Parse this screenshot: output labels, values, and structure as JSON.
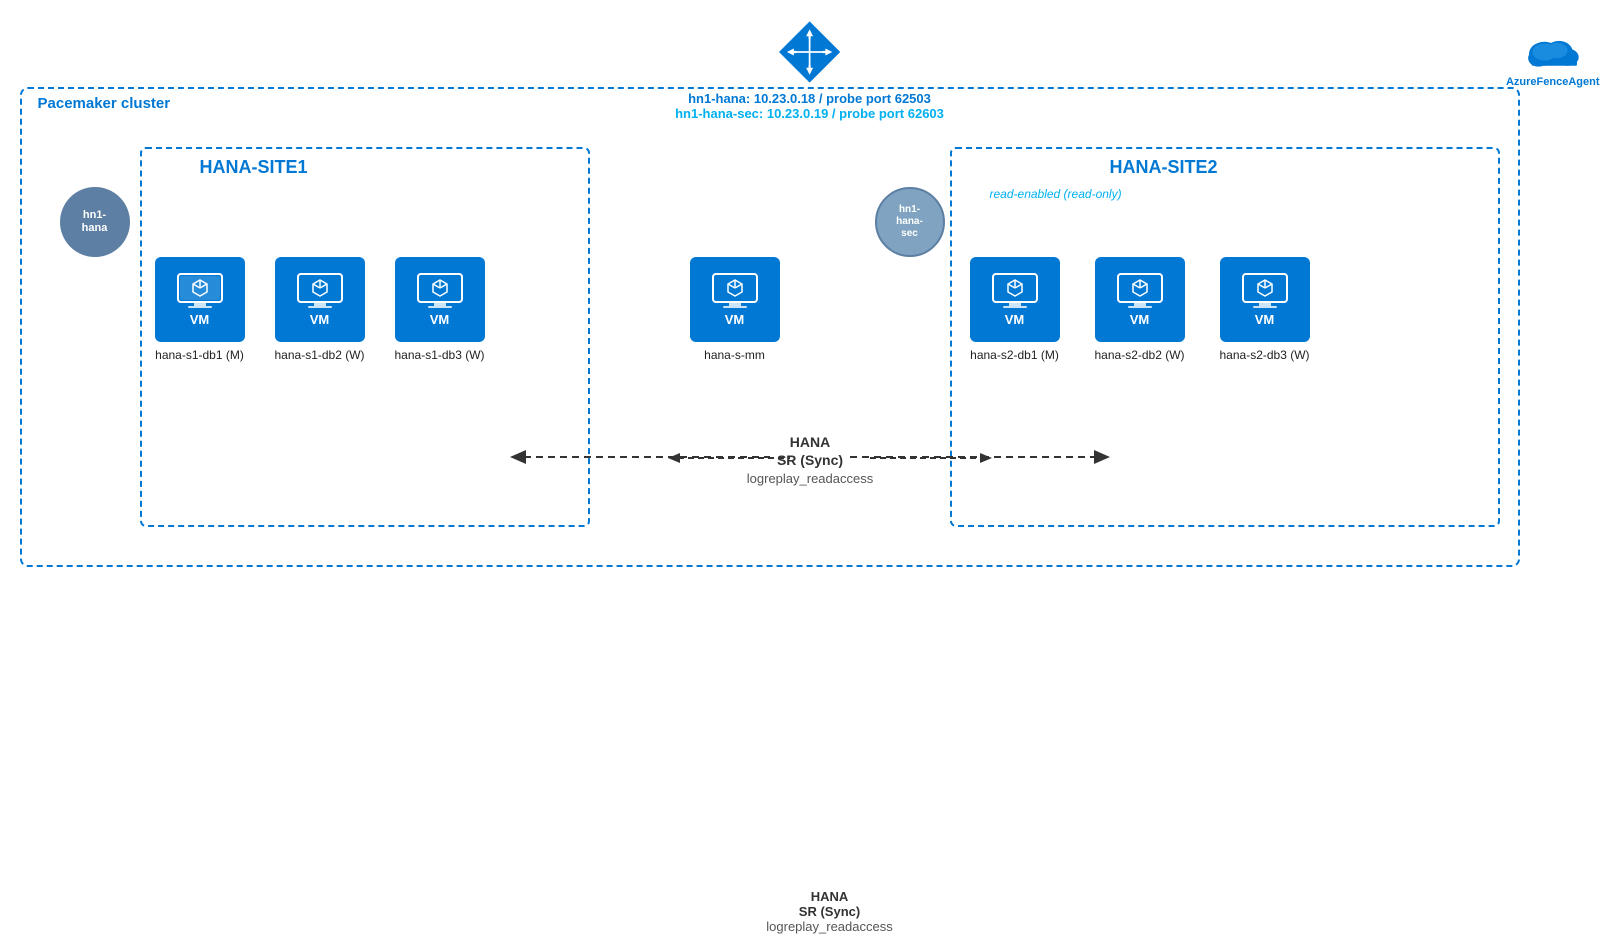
{
  "pacemaker": {
    "cluster_label": "Pacemaker cluster"
  },
  "lb": {
    "primary": "hn1-hana:  10.23.0.18 / probe port 62503",
    "secondary": "hn1-hana-sec:  10.23.0.19 / probe port 62603"
  },
  "azure_fence": {
    "label": "AzureFenceAgent"
  },
  "site1": {
    "label": "HANA-SITE1",
    "node_circle": "hn1-\nhana"
  },
  "site2": {
    "label": "HANA-SITE2",
    "node_circle": "hn1-\nhana-\nsec",
    "read_enabled": "read-enabled (read-only)"
  },
  "vms": [
    {
      "id": "s1-db1",
      "name": "hana-s1-db1 (M)"
    },
    {
      "id": "s1-db2",
      "name": "hana-s1-db2 (W)"
    },
    {
      "id": "s1-db3",
      "name": "hana-s1-db3 (W)"
    },
    {
      "id": "s-mm",
      "name": "hana-s-mm"
    },
    {
      "id": "s2-db1",
      "name": "hana-s2-db1 (M)"
    },
    {
      "id": "s2-db2",
      "name": "hana-s2-db2 (W)"
    },
    {
      "id": "s2-db3",
      "name": "hana-s2-db3 (W)"
    }
  ],
  "vm_box_label": "VM",
  "hana_sr": {
    "line1": "HANA",
    "line2": "SR (Sync)",
    "line3": "logreplay_readaccess"
  }
}
